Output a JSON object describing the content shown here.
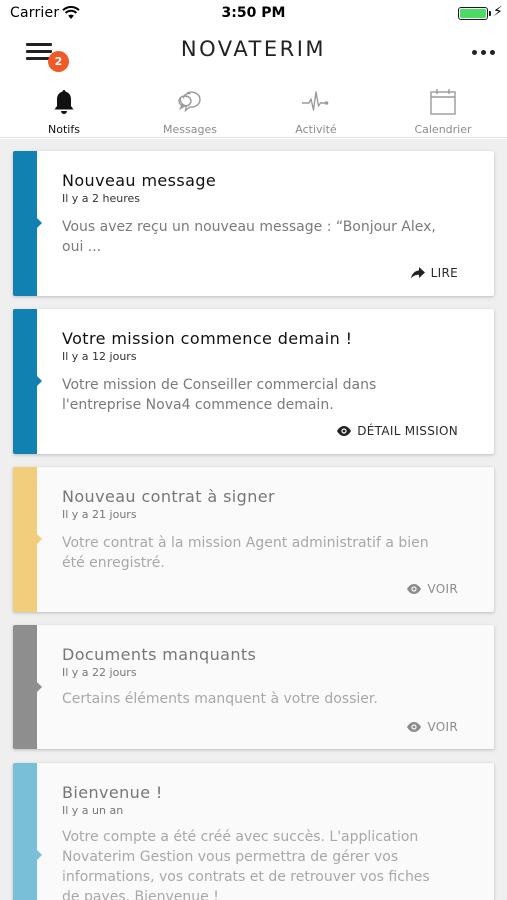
{
  "status_bar": {
    "carrier": "Carrier",
    "time": "3:50 PM"
  },
  "header": {
    "title": "NOVATERIM",
    "badge_count": "2"
  },
  "tabs": [
    {
      "label": "Notifs",
      "icon": "bell-icon",
      "active": true
    },
    {
      "label": "Messages",
      "icon": "chat-bubble-icon",
      "active": false
    },
    {
      "label": "Activité",
      "icon": "pulse-icon",
      "active": false
    },
    {
      "label": "Calendrier",
      "icon": "calendar-icon",
      "active": false
    }
  ],
  "notifications": [
    {
      "title": "Nouveau message",
      "time": "Il y a 2 heures",
      "body_lines": [
        "Vous avez reçu un nouveau message : “Bonjour Alex,",
        "oui ..."
      ],
      "action": "LIRE",
      "action_icon": "reply-arrow-icon",
      "color": "#1181b2",
      "read": false
    },
    {
      "title": "Votre mission commence demain !",
      "time": "Il y a 12 jours",
      "body_lines": [
        "Votre mission de Conseiller commercial dans",
        "l'entreprise Nova4 commence demain."
      ],
      "action": "DÉTAIL MISSION",
      "action_icon": "eye-icon",
      "color": "#1181b2",
      "read": false
    },
    {
      "title": "Nouveau contrat à signer",
      "time": "Il y a 21 jours",
      "body_lines": [
        "Votre contrat à la mission Agent administratif a bien",
        "été enregistré."
      ],
      "action": "VOIR",
      "action_icon": "eye-icon",
      "color": "#f1cd7c",
      "read": true
    },
    {
      "title": "Documents manquants",
      "time": "Il y a 22 jours",
      "body_lines": [
        "Certains éléments manquent à votre dossier."
      ],
      "action": "VOIR",
      "action_icon": "eye-icon",
      "color": "#8e8e8e",
      "read": true
    },
    {
      "title": "Bienvenue !",
      "time": "Il y a un an",
      "body_lines": [
        "Votre compte a été créé avec succès. L'application",
        "Novaterim Gestion vous permettra de gérer vos",
        "informations, vos contrats et de retrouver vos fiches",
        "de payes. Bienvenue !"
      ],
      "action": "",
      "action_icon": "",
      "color": "#79bfd8",
      "read": true
    }
  ]
}
